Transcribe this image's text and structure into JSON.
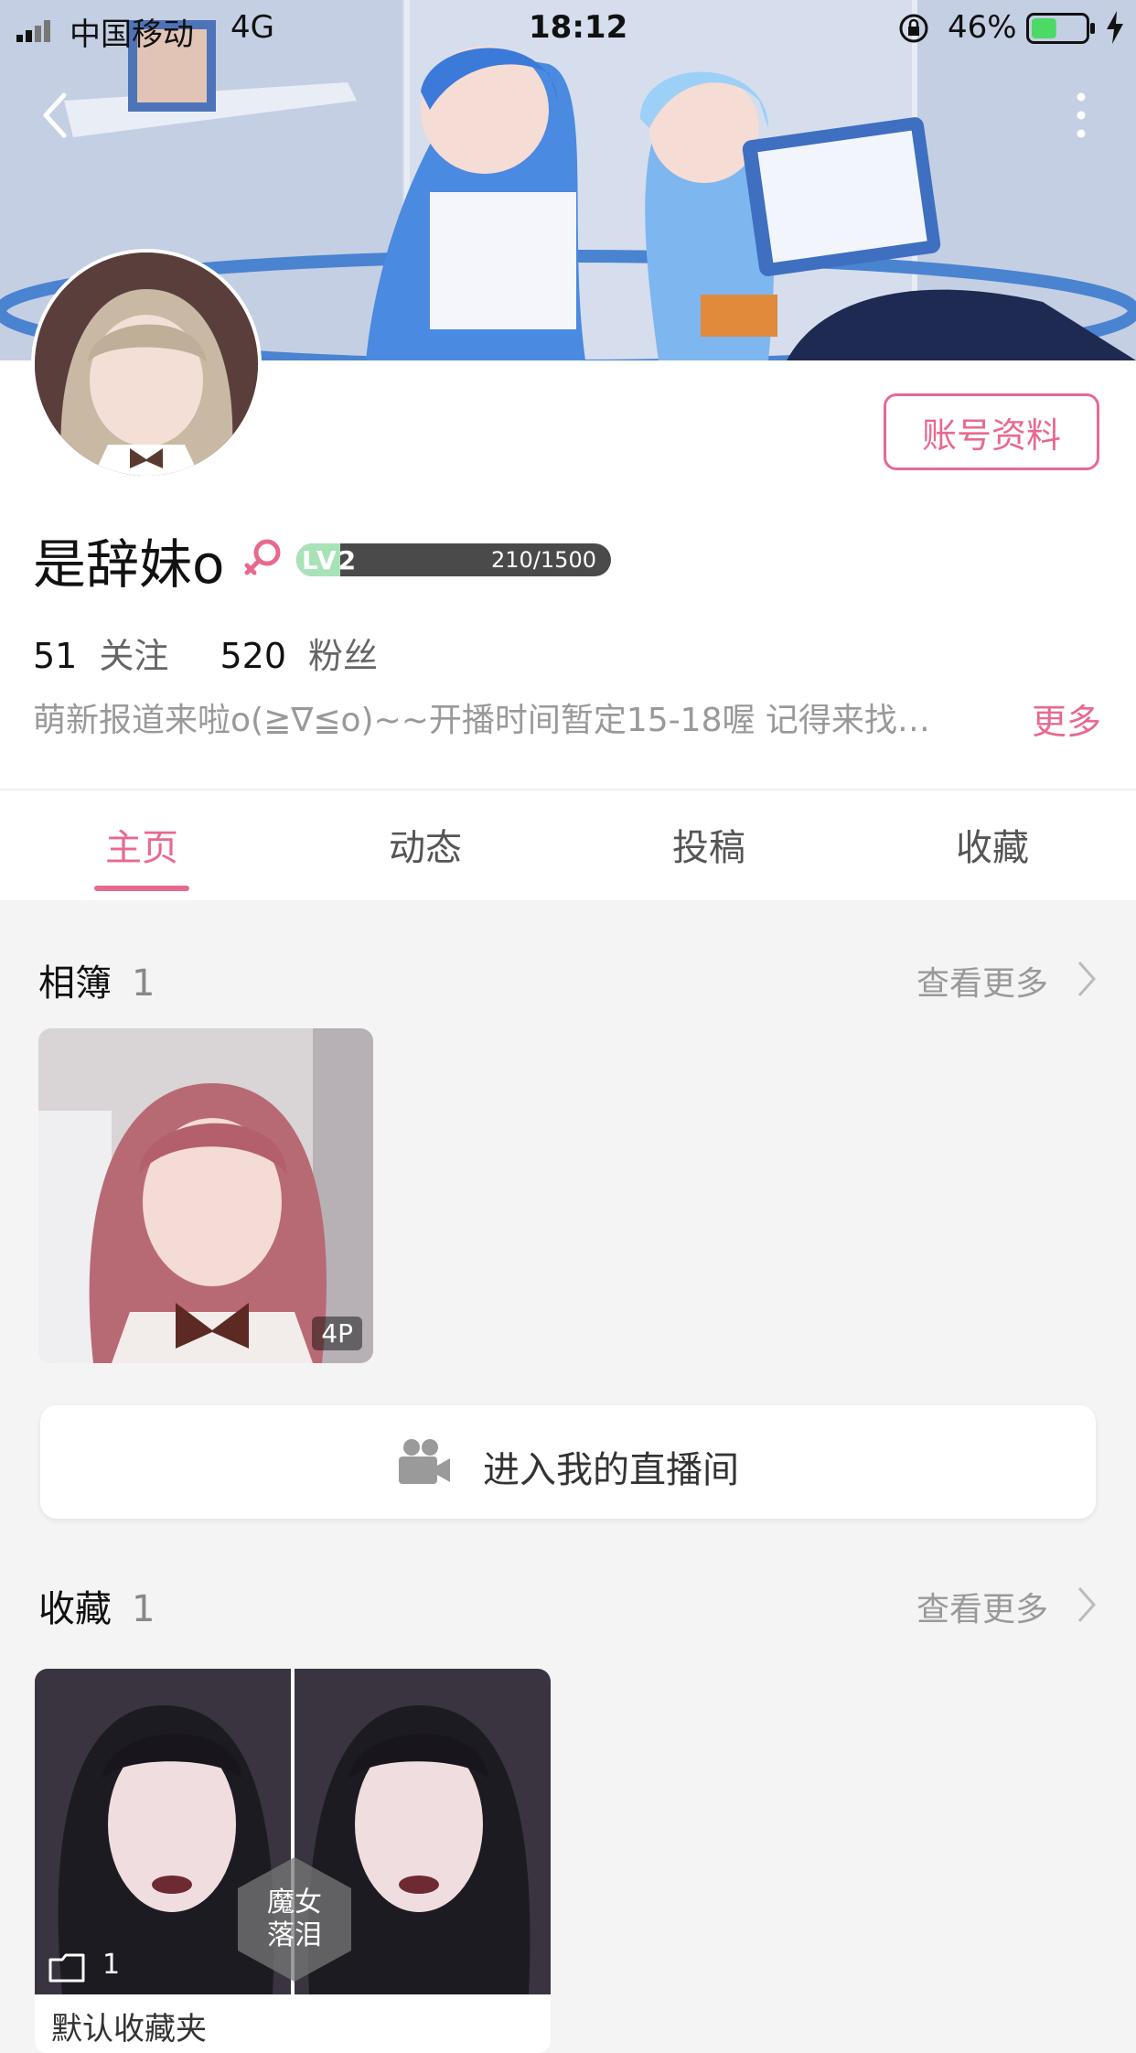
{
  "status_bar": {
    "carrier": "中国移动",
    "network": "4G",
    "time": "18:12",
    "battery_percent": "46%",
    "battery_level": 0.46
  },
  "header": {
    "back_icon": "chevron-left-icon",
    "more_icon": "more-vertical-icon"
  },
  "profile": {
    "account_button": "账号资料",
    "username": "是辞妹o",
    "gender_icon": "female-icon",
    "level_label": "LV2",
    "level_exp": "210/1500",
    "level_progress": 0.14,
    "following_count": "51",
    "following_label": "关注",
    "followers_count": "520",
    "followers_label": "粉丝",
    "bio": "萌新报道来啦o(≧∇≦o)~~开播时间暂定15-18喔 记得来找…",
    "bio_more": "更多"
  },
  "tabs": [
    {
      "label": "主页",
      "active": true
    },
    {
      "label": "动态",
      "active": false
    },
    {
      "label": "投稿",
      "active": false
    },
    {
      "label": "收藏",
      "active": false
    }
  ],
  "album_section": {
    "title": "相簿",
    "count": "1",
    "see_more": "查看更多",
    "items": [
      {
        "badge": "4P"
      }
    ]
  },
  "live_room": {
    "icon": "video-camera-icon",
    "label": "进入我的直播间"
  },
  "favorites_section": {
    "title": "收藏",
    "count": "1",
    "see_more": "查看更多",
    "items": [
      {
        "tag_line1": "魔女",
        "tag_line2": "落泪",
        "count": "1",
        "caption": "默认收藏夹"
      }
    ]
  },
  "colors": {
    "accent": "#e8698e",
    "level_fill": "#a8e3b8",
    "banner": "#b8c6de"
  }
}
